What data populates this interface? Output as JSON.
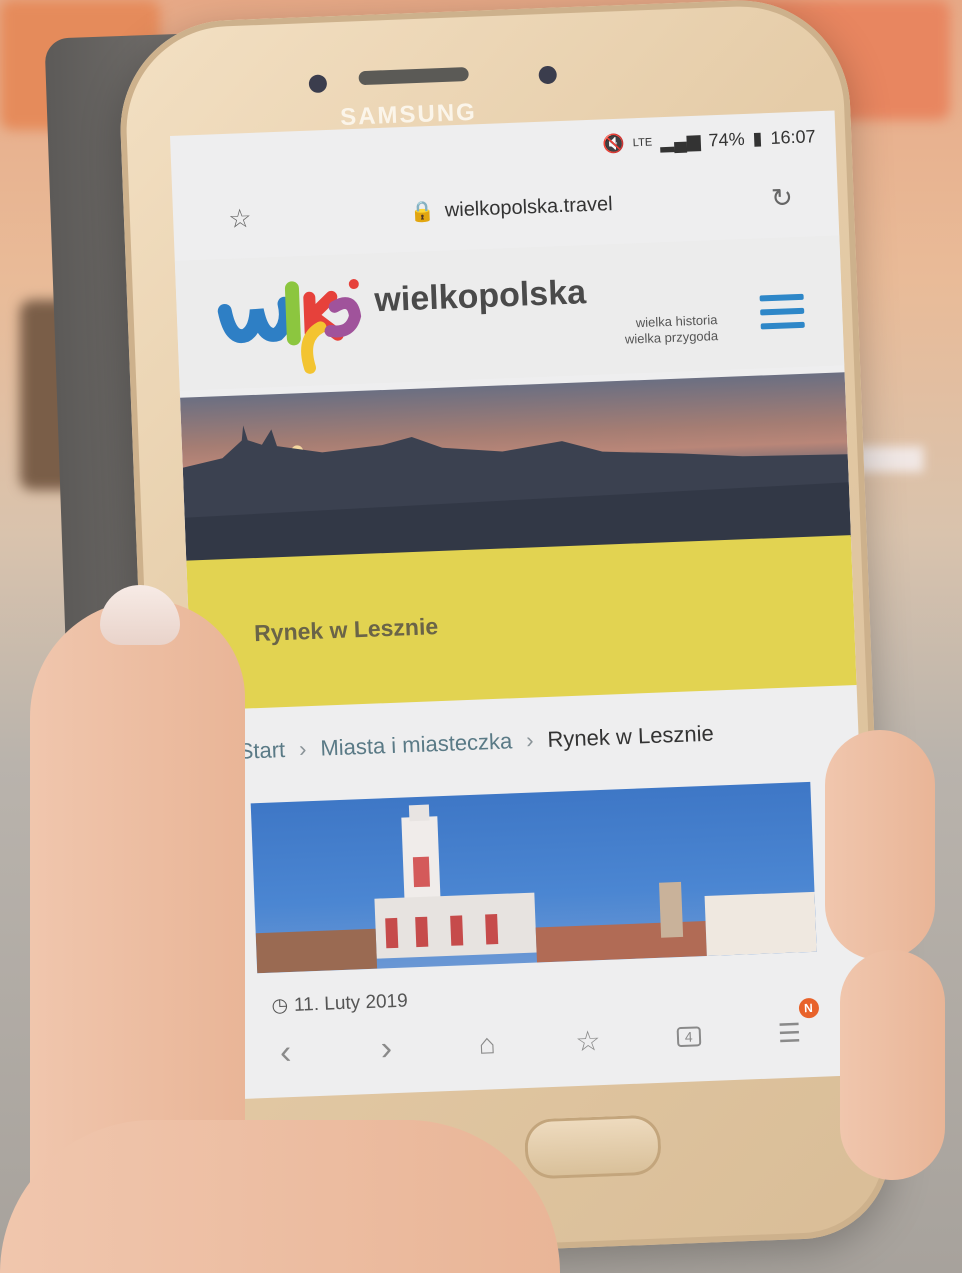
{
  "device": {
    "brand": "SAMSUNG"
  },
  "status_bar": {
    "network": "LTE",
    "battery": "74%",
    "time": "16:07"
  },
  "browser": {
    "url": "wielkopolska.travel"
  },
  "site": {
    "name": "wielkopolska",
    "tagline_1": "wielka historia",
    "tagline_2": "wielka przygoda"
  },
  "page": {
    "title": "Rynek w Lesznie",
    "breadcrumb": [
      {
        "label": "Start"
      },
      {
        "label": "Miasta i miasteczka"
      },
      {
        "label": "Rynek w Lesznie"
      }
    ],
    "date": "11. Luty 2019"
  },
  "bottom_nav": {
    "tab_count": "4",
    "menu_badge": "N"
  },
  "colors": {
    "title_band": "#e2d351",
    "accent": "#2e87c8",
    "badge": "#e8622a"
  }
}
